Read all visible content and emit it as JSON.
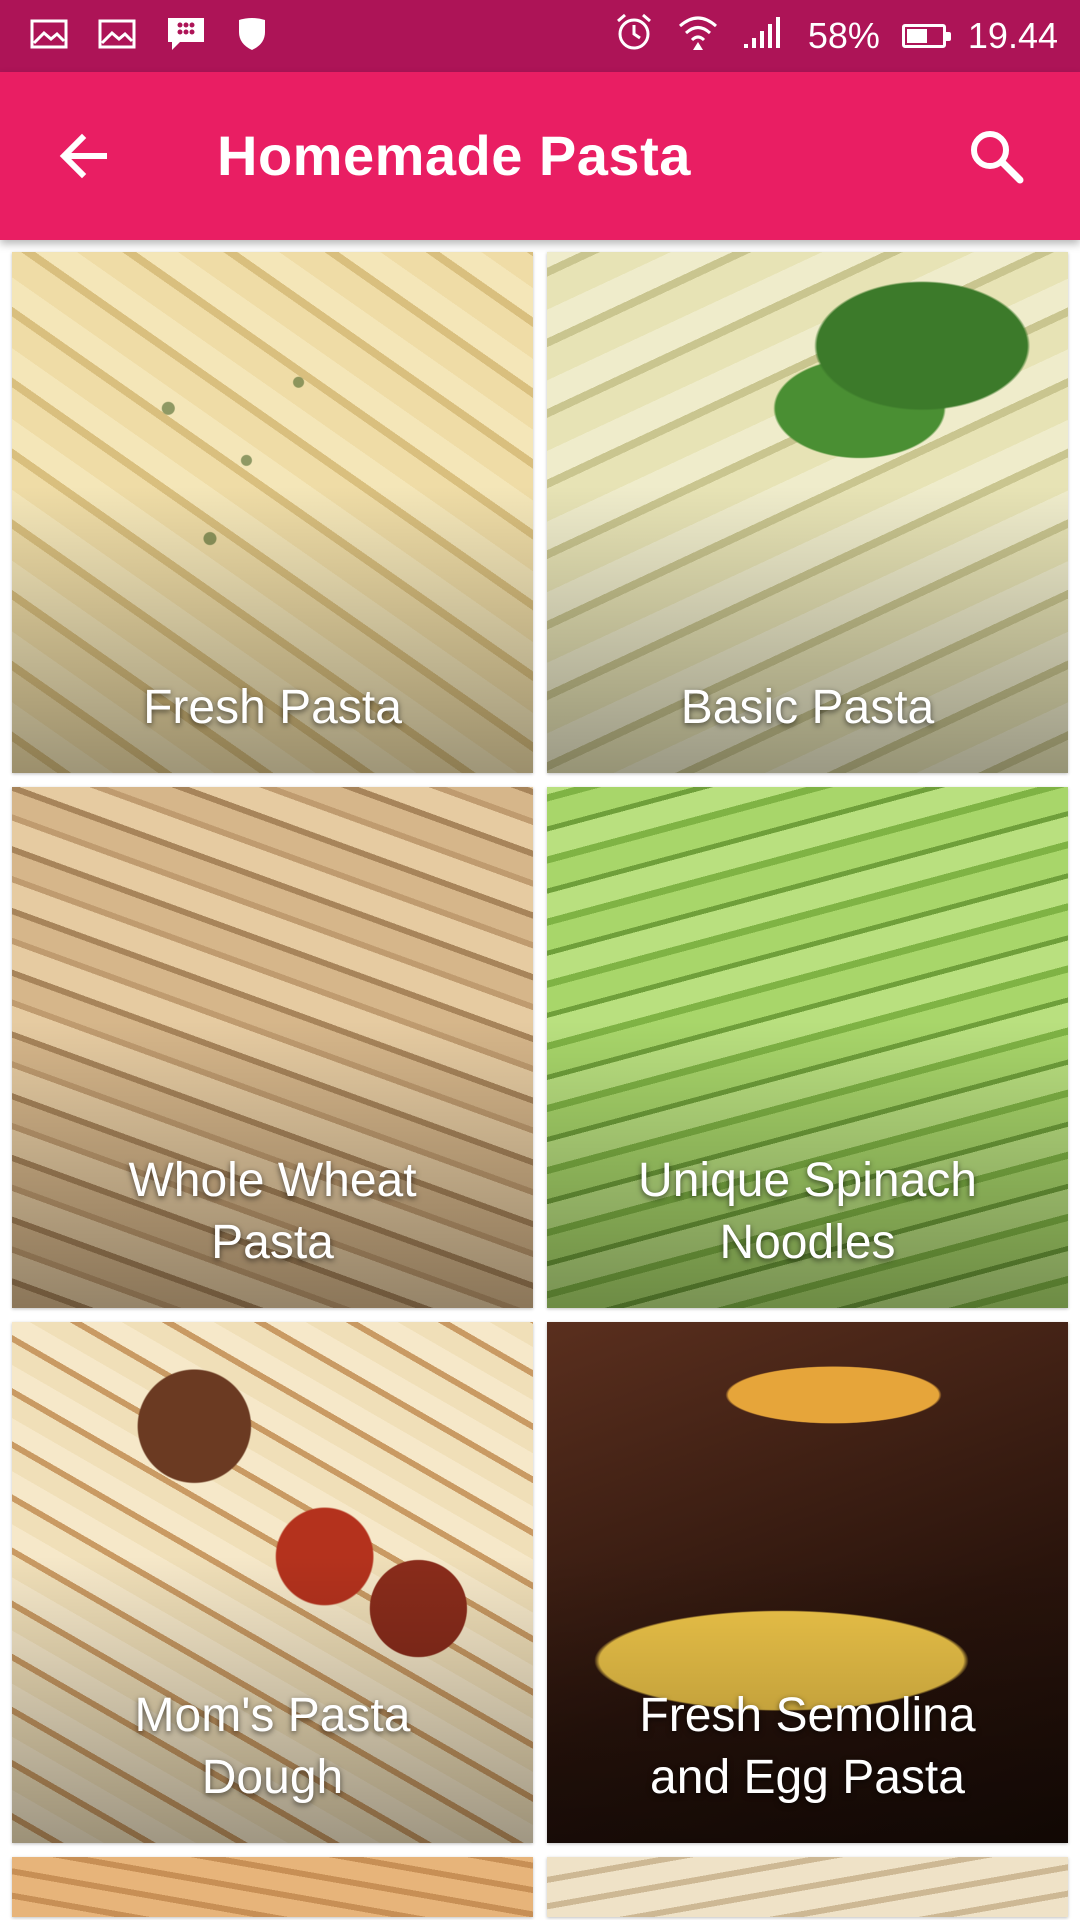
{
  "status_bar": {
    "battery_percent": "58%",
    "time": "19.44",
    "left_icons": [
      "gallery-icon",
      "gallery-icon",
      "blackberry-messenger-icon",
      "shield-icon"
    ],
    "right_icons": [
      "alarm-icon",
      "wifi-icon",
      "signal-icon",
      "battery-icon"
    ],
    "battery_level": 0.58
  },
  "app_bar": {
    "title": "Homemade Pasta",
    "back_icon": "arrow-back-icon",
    "search_icon": "search-icon"
  },
  "colors": {
    "status_bar": "#ad1457",
    "app_bar": "#e91e63"
  },
  "recipes": [
    {
      "label": "Fresh Pasta"
    },
    {
      "label": "Basic Pasta"
    },
    {
      "label": "Whole Wheat\nPasta"
    },
    {
      "label": "Unique Spinach\nNoodles"
    },
    {
      "label": "Mom's Pasta\nDough"
    },
    {
      "label": "Fresh Semolina\nand Egg Pasta"
    }
  ]
}
